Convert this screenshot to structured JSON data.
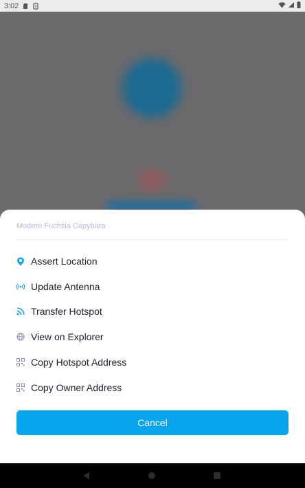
{
  "status_bar": {
    "time": "3:02",
    "icons": [
      "sd-card-icon",
      "sync-icon",
      "wifi-icon",
      "signal-icon",
      "battery-icon"
    ]
  },
  "sheet": {
    "title": "Modern Fuchsia Capybara",
    "items": [
      {
        "label": "Assert Location",
        "icon": "location-pin-icon"
      },
      {
        "label": "Update Antenna",
        "icon": "antenna-icon"
      },
      {
        "label": "Transfer Hotspot",
        "icon": "transfer-icon"
      },
      {
        "label": "View on Explorer",
        "icon": "globe-icon"
      },
      {
        "label": "Copy Hotspot Address",
        "icon": "qr-code-icon"
      },
      {
        "label": "Copy Owner Address",
        "icon": "qr-code-icon"
      }
    ],
    "cancel_label": "Cancel"
  },
  "nav_bar": {
    "buttons": [
      "back-icon",
      "home-icon",
      "recents-icon"
    ]
  },
  "colors": {
    "accent": "#08a4ee",
    "title_text": "#b8b5d6",
    "icon_blue": "#1aa3e6",
    "icon_gray": "#8f8daf",
    "scrim": "#6b6a6c"
  }
}
